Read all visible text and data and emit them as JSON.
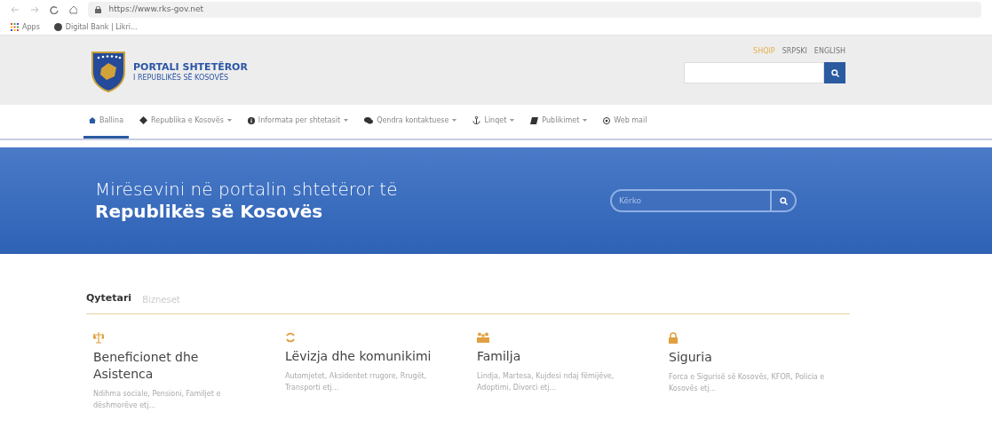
{
  "browser": {
    "url": "https://www.rks-gov.net",
    "bookmarks": [
      "Apps",
      "Digital Bank | Likri..."
    ]
  },
  "header": {
    "logo_title": "PORTALI SHTETËROR",
    "logo_subtitle": "I REPUBLIKËS SË KOSOVËS",
    "languages": [
      {
        "label": "SHQIP",
        "selected": true
      },
      {
        "label": "SRPSKI",
        "selected": false
      },
      {
        "label": "ENGLISH",
        "selected": false
      }
    ]
  },
  "nav": [
    {
      "label": "Ballina",
      "kind": "home",
      "dropdown": false,
      "selected": true
    },
    {
      "label": "Republika e Kosovës",
      "kind": "map",
      "dropdown": true,
      "selected": false
    },
    {
      "label": "Informata per shtetasit",
      "kind": "info",
      "dropdown": true,
      "selected": false
    },
    {
      "label": "Qendra kontaktuese",
      "kind": "chat",
      "dropdown": true,
      "selected": false
    },
    {
      "label": "Linqet",
      "kind": "anchor",
      "dropdown": true,
      "selected": false
    },
    {
      "label": "Publikimet",
      "kind": "book",
      "dropdown": true,
      "selected": false
    },
    {
      "label": "Web mail",
      "kind": "at",
      "dropdown": false,
      "selected": false
    }
  ],
  "hero": {
    "line_1": "Mirësevini në portalin shtetëror të",
    "line_2": "Republikës së Kosovës",
    "search_placeholder": "Kërko"
  },
  "tabs": [
    {
      "label": "Qytetari",
      "selected": true
    },
    {
      "label": "Bizneset",
      "selected": false
    }
  ],
  "categories": [
    {
      "kind": "scales",
      "title": "Beneficionet dhe Asistenca",
      "description": "Ndihma sociale, Pensioni, Familjet e dëshmorëve etj..."
    },
    {
      "kind": "refresh",
      "title": "Lëvizja dhe komunikimi",
      "description": "Automjetet, Aksidentet rrugore, Rrugët, Transporti etj..."
    },
    {
      "kind": "family",
      "title": "Familja",
      "description": "Lindja, Martesa, Kujdesi ndaj fëmijëve, Adoptimi, Divorci etj..."
    },
    {
      "kind": "lock",
      "title": "Siguria",
      "description": "Forca e Sigurisë së Kosovës, KFOR, Policia e Kosovës etj..."
    }
  ]
}
